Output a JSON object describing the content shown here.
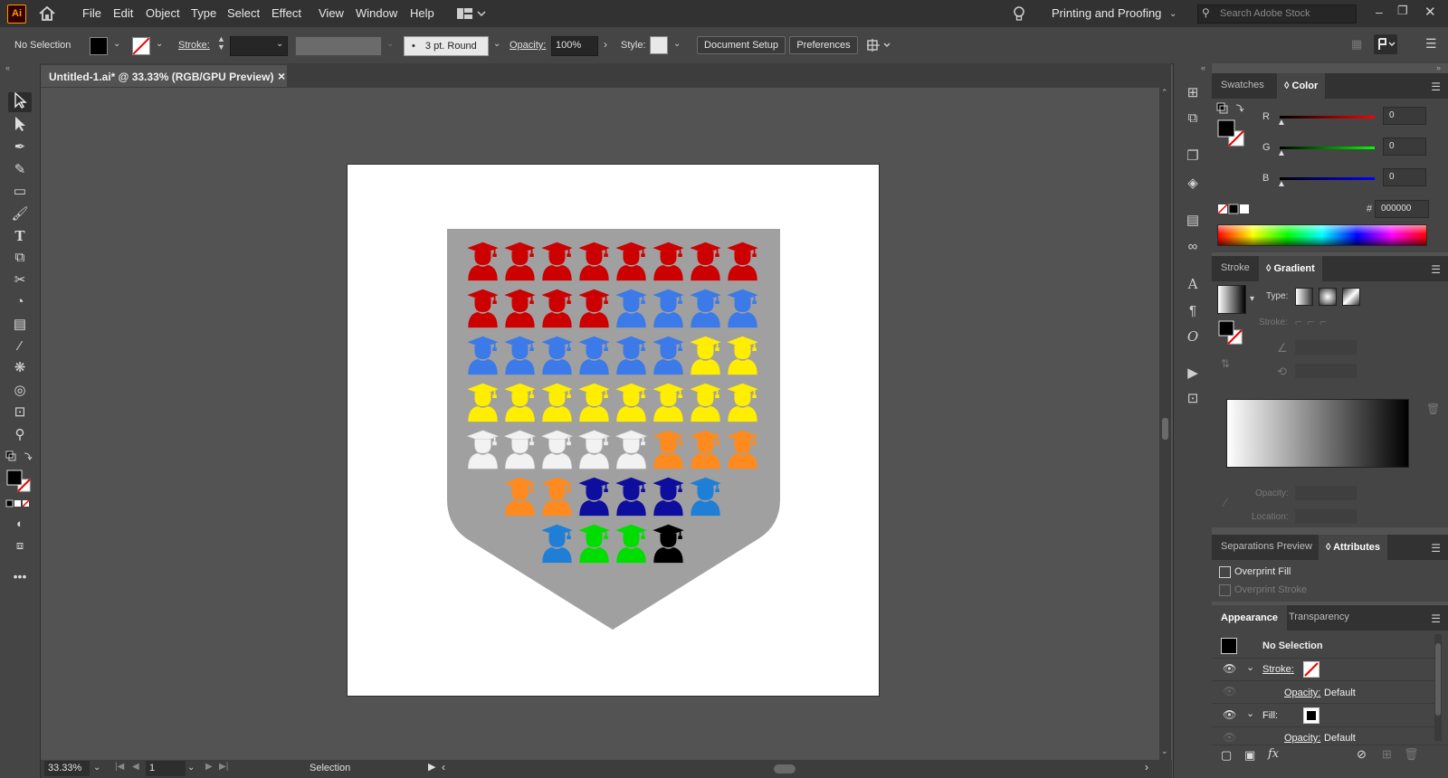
{
  "app": {
    "logo": "Ai",
    "menus": [
      "File",
      "Edit",
      "Object",
      "Type",
      "Select",
      "Effect",
      "View",
      "Window",
      "Help"
    ],
    "workspace": "Printing and Proofing",
    "search_placeholder": "Search Adobe Stock"
  },
  "control": {
    "selection": "No Selection",
    "stroke_label": "Stroke:",
    "brush": "3 pt. Round",
    "opacity_label": "Opacity:",
    "opacity_value": "100%",
    "style_label": "Style:",
    "document_setup": "Document Setup",
    "preferences": "Preferences"
  },
  "document": {
    "tab_title": "Untitled-1.ai* @ 33.33% (RGB/GPU Preview)",
    "close": "×"
  },
  "status": {
    "zoom": "33.33%",
    "page": "1",
    "tool": "Selection"
  },
  "swatches_panel": {
    "tabs": [
      "Swatches",
      "Color"
    ],
    "r_label": "R",
    "g_label": "G",
    "b_label": "B",
    "r_value": "0",
    "g_value": "0",
    "b_value": "0",
    "hash": "#",
    "hex_value": "000000"
  },
  "gradient_panel": {
    "tabs": [
      "Stroke",
      "Gradient"
    ],
    "type_label": "Type:",
    "stroke_label": "Stroke:",
    "opacity_label": "Opacity:",
    "location_label": "Location:"
  },
  "attributes_panel": {
    "tabs": [
      "Separations Preview",
      "Attributes"
    ],
    "overprint_fill": "Overprint Fill",
    "overprint_stroke": "Overprint Stroke"
  },
  "appearance_panel": {
    "tabs": [
      "Appearance",
      "Transparency"
    ],
    "title": "No Selection",
    "stroke_label": "Stroke:",
    "opacity_label": "Opacity:",
    "opacity_value": "Default",
    "fill_label": "Fill:",
    "opacity2_label": "Opacity:",
    "opacity2_value": "Default"
  },
  "artwork": {
    "shield_color": "#a0a0a0",
    "rows": [
      [
        "#cc0000",
        "#cc0000",
        "#cc0000",
        "#cc0000",
        "#cc0000",
        "#cc0000",
        "#cc0000",
        "#cc0000"
      ],
      [
        "#cc0000",
        "#cc0000",
        "#cc0000",
        "#cc0000",
        "#3b7ae8",
        "#3b7ae8",
        "#3b7ae8",
        "#3b7ae8"
      ],
      [
        "#3b7ae8",
        "#3b7ae8",
        "#3b7ae8",
        "#3b7ae8",
        "#3b7ae8",
        "#3b7ae8",
        "#ffee00",
        "#ffee00"
      ],
      [
        "#ffee00",
        "#ffee00",
        "#ffee00",
        "#ffee00",
        "#ffee00",
        "#ffee00",
        "#ffee00",
        "#ffee00"
      ],
      [
        "#f2f2f2",
        "#f2f2f2",
        "#f2f2f2",
        "#f2f2f2",
        "#f2f2f2",
        "#ff8a1f",
        "#ff8a1f",
        "#ff8a1f"
      ],
      [
        "#ff8a1f",
        "#ff8a1f",
        "#0d0d9e",
        "#0d0d9e",
        "#0d0d9e",
        "#1f7fd6"
      ],
      [
        "#1f7fd6",
        "#00dd00",
        "#00dd00",
        "#000000"
      ]
    ]
  }
}
